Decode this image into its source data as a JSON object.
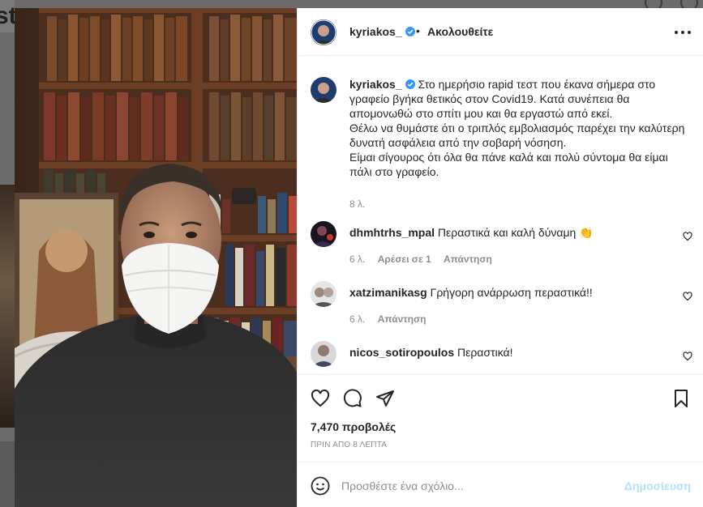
{
  "background_page": {
    "title_fragment": "st"
  },
  "header": {
    "username": "kyriakos_",
    "dot": "•",
    "follow_label": "Ακολουθείτε"
  },
  "caption": {
    "username": "kyriakos_",
    "text": "Στο ημερήσιο rapid τεστ που έκανα σήμερα στο γραφείο βγήκα θετικός στον Covid19. Κατά συνέπεια θα απομονωθώ στο σπίτι μου και θα εργαστώ από εκεί.\nΘέλω να θυμάστε ότι ο τριπλός εμβολιασμός παρέχει την καλύτερη δυνατή ασφάλεια από την σοβαρή νόσηση.\nΕίμαι σίγουρος ότι όλα θα πάνε καλά και πολύ σύντομα θα είμαι πάλι στο γραφείο.",
    "time": "8 λ."
  },
  "comments": [
    {
      "username": "dhmhtrhs_mpal",
      "text": "Περαστικά και καλή δύναμη",
      "emoji": "👏",
      "time": "6 λ.",
      "likes": "Αρέσει σε 1",
      "reply": "Απάντηση"
    },
    {
      "username": "xatzimanikasg",
      "text": "Γρήγορη ανάρρωση περαστικά!!",
      "time": "6 λ.",
      "reply": "Απάντηση"
    },
    {
      "username": "nicos_sotiropoulos",
      "text": "Περαστικά!"
    }
  ],
  "stats": {
    "views": "7,470 προβολές",
    "posted": "ΠΡΙΝ ΑΠΟ 8 ΛΕΠΤΑ"
  },
  "add_comment": {
    "placeholder": "Προσθέστε ένα σχόλιο...",
    "post_label": "Δημοσίευση"
  },
  "icons": {
    "verified": "verified-badge-icon",
    "more": "more-options-icon",
    "like": "heart-icon",
    "comment": "comment-bubble-icon",
    "share": "paper-plane-icon",
    "save": "bookmark-icon",
    "emoji": "smiley-icon"
  },
  "colors": {
    "text": "#262626",
    "secondary": "#8e8e8e",
    "verified": "#3897f0",
    "post_disabled": "#b2dffc",
    "divider": "#efefef"
  }
}
